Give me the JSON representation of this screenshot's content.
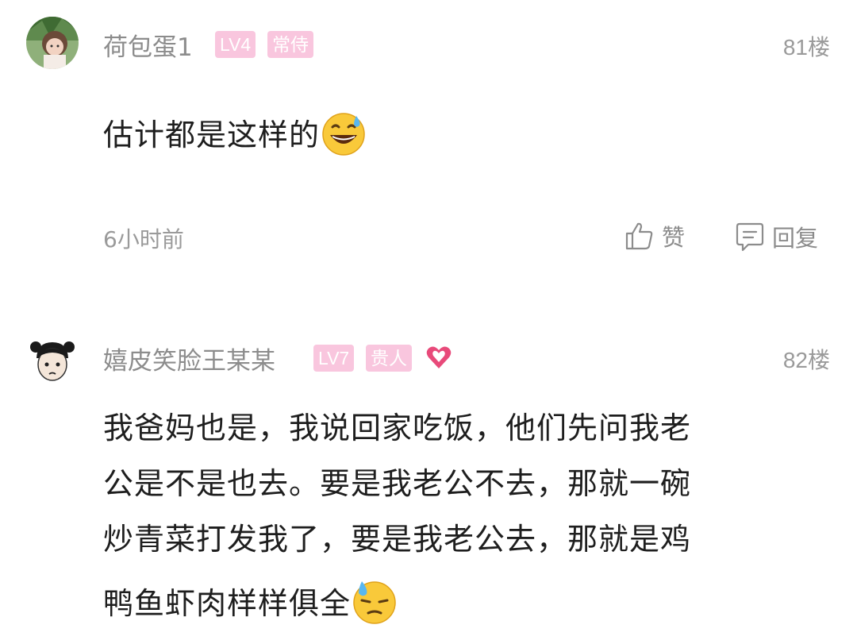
{
  "comments": [
    {
      "username": "荷包蛋1",
      "badges": [
        "LV4",
        "常侍"
      ],
      "floor": "81楼",
      "lines": [
        "估计都是这样的"
      ],
      "emoji": "grinning-sweat-emoji",
      "time": "6小时前",
      "like_label": "赞",
      "reply_label": "回复"
    },
    {
      "username": "嬉皮笑脸王某某",
      "badges": [
        "LV7",
        "贵人"
      ],
      "heart_badge": "heart-badge-icon",
      "floor": "82楼",
      "lines": [
        "我爸妈也是，我说回家吃饭，他们先问我老",
        "公是不是也去。要是我老公不去，那就一碗",
        "炒青菜打发我了，要是我老公去，那就是鸡",
        "鸭鱼虾肉样样俱全"
      ],
      "emoji": "downcast-sweat-emoji"
    }
  ],
  "colors": {
    "badge_bg": "#f9c6de",
    "username": "#8c8c8c",
    "meta": "#9a9a9a",
    "heart": "#e84a7a"
  }
}
